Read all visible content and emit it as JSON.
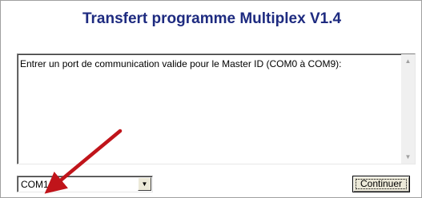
{
  "window": {
    "title": "Transfert programme Multiplex V1.4"
  },
  "message_box": {
    "text": "Entrer un port de communication valide pour le Master ID (COM0 à COM9):"
  },
  "port_select": {
    "value": "COM1"
  },
  "buttons": {
    "continue_label": "Continuer"
  },
  "icons": {
    "scroll_up": "scroll-up-arrow-icon",
    "scroll_down": "scroll-down-arrow-icon",
    "dropdown": "chevron-down-icon",
    "annotation": "red-arrow-icon"
  },
  "colors": {
    "title": "#1e2b80",
    "annotation_arrow": "#c0141a"
  }
}
